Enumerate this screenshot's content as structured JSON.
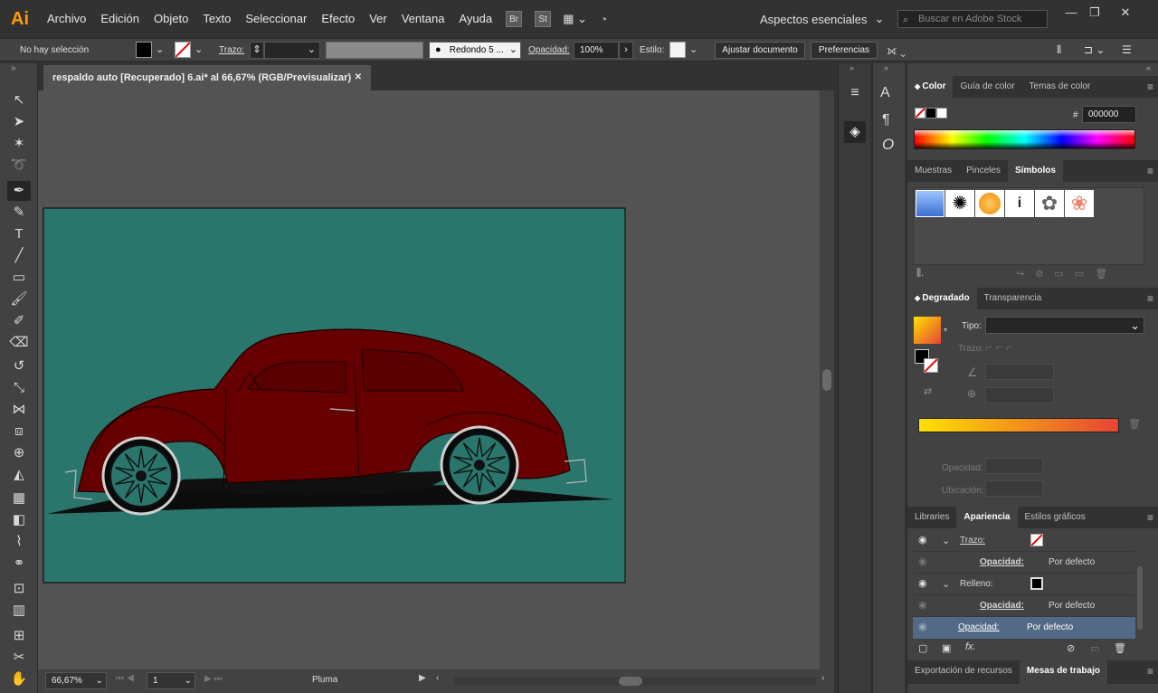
{
  "app": {
    "logo": "Ai"
  },
  "menu": [
    "Archivo",
    "Edición",
    "Objeto",
    "Texto",
    "Seleccionar",
    "Efecto",
    "Ver",
    "Ventana",
    "Ayuda"
  ],
  "bridge": {
    "br": "Br",
    "st": "St"
  },
  "workspace": {
    "label": "Aspectos esenciales"
  },
  "search": {
    "placeholder": "Buscar en Adobe Stock"
  },
  "control": {
    "selection": "No hay selección",
    "stroke_label": "Trazo:",
    "brush": "Redondo 5 ...",
    "opacity_label": "Opacidad:",
    "opacity_value": "100%",
    "style_label": "Estilo:",
    "doc_setup": "Ajustar documento",
    "preferences": "Preferencias"
  },
  "document": {
    "tab_title": "respaldo auto [Recuperado] 6.ai* al 66,67% (RGB/Previsualizar)",
    "close": "✕",
    "zoom": "66,67%",
    "artboard": "1",
    "tool_status": "Pluma",
    "artboard_color": "#2a766c",
    "body_color": "#660000"
  },
  "color_panel": {
    "tabs": [
      "Color",
      "Guía de color",
      "Temas de color"
    ],
    "hex_prefix": "#",
    "hex": "000000"
  },
  "symbols_panel": {
    "tabs": [
      "Muestras",
      "Pinceles",
      "Símbolos"
    ]
  },
  "gradient_panel": {
    "tabs": [
      "Degradado",
      "Transparencia"
    ],
    "type_label": "Tipo:",
    "stroke_label": "Trazo:",
    "opacity_label": "Opacidad:",
    "location_label": "Ubicación:",
    "start_color": "#ffe100",
    "end_color": "#e54436"
  },
  "appearance_panel": {
    "tabs": [
      "Libraries",
      "Apariencia",
      "Estilos gráficos"
    ],
    "rows": [
      {
        "label": "Trazo:",
        "value": ""
      },
      {
        "label": "Opacidad:",
        "value": "Por defecto"
      },
      {
        "label": "Relleno:",
        "value": ""
      },
      {
        "label": "Opacidad:",
        "value": "Por defecto"
      },
      {
        "label": "Opacidad:",
        "value": "Por defecto"
      }
    ]
  },
  "bottom_panel": {
    "tabs": [
      "Exportación de recursos",
      "Mesas de trabajo"
    ]
  },
  "icons": {
    "collapse": "»",
    "menu": "≡",
    "eye": "◉",
    "fx": "fx."
  }
}
